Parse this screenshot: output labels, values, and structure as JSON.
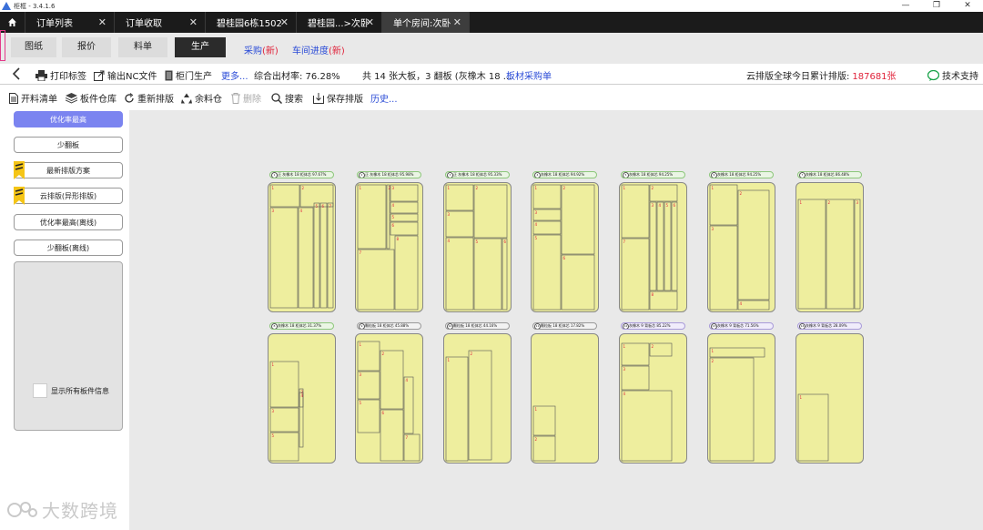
{
  "window": {
    "title": "柜框 - 3.4.1.6",
    "controls": [
      "—",
      "❐",
      "✕"
    ]
  },
  "tabs": [
    {
      "label": "订单列表",
      "active": false
    },
    {
      "label": "订单收取",
      "active": false
    },
    {
      "label": "碧桂园6栋1502",
      "active": false
    },
    {
      "label": "碧桂园...>次卧",
      "active": false
    },
    {
      "label": "单个房间:次卧",
      "active": true
    }
  ],
  "subnav": {
    "pills": [
      "图纸",
      "报价",
      "料单",
      "生产"
    ],
    "purchase": {
      "label": "采购",
      "badge": "(新)"
    },
    "workshop": {
      "label": "车间进度",
      "badge": "(新)"
    }
  },
  "toolbar1": {
    "print_label": "打印标签",
    "nc_label": "输出NC文件",
    "door_label": "柜门生产",
    "more_label": "更多...",
    "yield_label": "综合出材率: 76.28%",
    "summary": "共 14 张大板，3 翻板 (灰橡木 18 ...",
    "purchase_sheet": "板材采购单",
    "cloud_label": "云排版全球今日累计排版:",
    "cloud_count": "187681张",
    "support_label": "技术支持"
  },
  "toolbar2": {
    "cut_list": "开料清单",
    "warehouse": "板件仓库",
    "rearrange": "重新排版",
    "leftover": "余料仓",
    "delete": "删除",
    "search": "搜索",
    "save": "保存排版",
    "history": "历史..."
  },
  "sidebar": {
    "buttons": [
      "优化率最高",
      "少翻板",
      "最新排版方案",
      "云排版(异形排版)",
      "优化率最高(离线)",
      "少翻板(离线)"
    ],
    "show_all": "显示所有板件信息"
  },
  "watermark": "大数跨境",
  "boards": [
    {
      "header": "正 灰橡木 18 柜体芯 97.67%",
      "n": "1"
    },
    {
      "header": "正 灰橡木 18 柜体芯 95.98%",
      "n": "2"
    },
    {
      "header": "正 灰橡木 18 柜体芯 95.33%",
      "n": "3"
    },
    {
      "header": "灰橡木 18 柜体芯 94.92%",
      "n": "4"
    },
    {
      "header": "灰橡木 18 柜体芯 94.25%",
      "n": "5"
    },
    {
      "header": "灰橡木 18 柜体芯 94.25%",
      "n": "6"
    },
    {
      "header": "灰橡木 18 柜体芯 86.48%",
      "n": "7"
    },
    {
      "header": "灰橡木 18 柜体芯 31.37%",
      "n": "8"
    },
    {
      "header": "颗粒板 18 柜体芯 45.88%",
      "n": "9"
    },
    {
      "header": "颗粒板 18 柜体芯 44.16%",
      "n": "10"
    },
    {
      "header": "颗粒板 18 柜体芯 17.82%",
      "n": "11"
    },
    {
      "header": "灰橡木 9 背板芯 85.22%",
      "n": "12"
    },
    {
      "header": "灰橡木 9 背板芯 71.56%",
      "n": "13"
    },
    {
      "header": "灰橡木 9 背板芯 28.09%",
      "n": "14"
    }
  ],
  "colors": {
    "accent_purple": "#7b84f0",
    "link_blue": "#2a4bd7",
    "alert_red": "#e0223a",
    "board_yellow": "#eeee9e"
  }
}
